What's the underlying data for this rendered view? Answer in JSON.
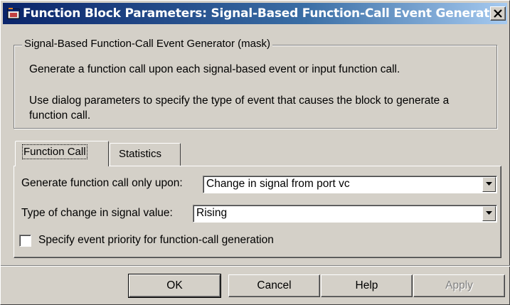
{
  "window": {
    "title": "Function Block Parameters: Signal-Based Function-Call Event Generator",
    "accent": "#0a246a"
  },
  "mask": {
    "group_title": "Signal-Based Function-Call Event Generator (mask)",
    "description_line1": "Generate a function call upon each signal-based event or input function call.",
    "description_line2a": "Use dialog parameters to specify the type of event that causes the block to generate a",
    "description_line2b": "function call."
  },
  "tabs": [
    {
      "label": "Function Call",
      "active": true
    },
    {
      "label": "Statistics",
      "active": false
    }
  ],
  "params": {
    "generate_label": "Generate function call only upon:",
    "generate_value": "Change in signal from port vc",
    "change_type_label": "Type of change in signal value:",
    "change_type_value": "Rising",
    "priority_label": "Specify event priority for function-call generation",
    "priority_checked": false
  },
  "buttons": {
    "ok": "OK",
    "cancel": "Cancel",
    "help": "Help",
    "apply": "Apply"
  },
  "icons": {
    "app": "simulink-block-icon",
    "close": "close-icon",
    "dropdown": "chevron-down-icon"
  }
}
